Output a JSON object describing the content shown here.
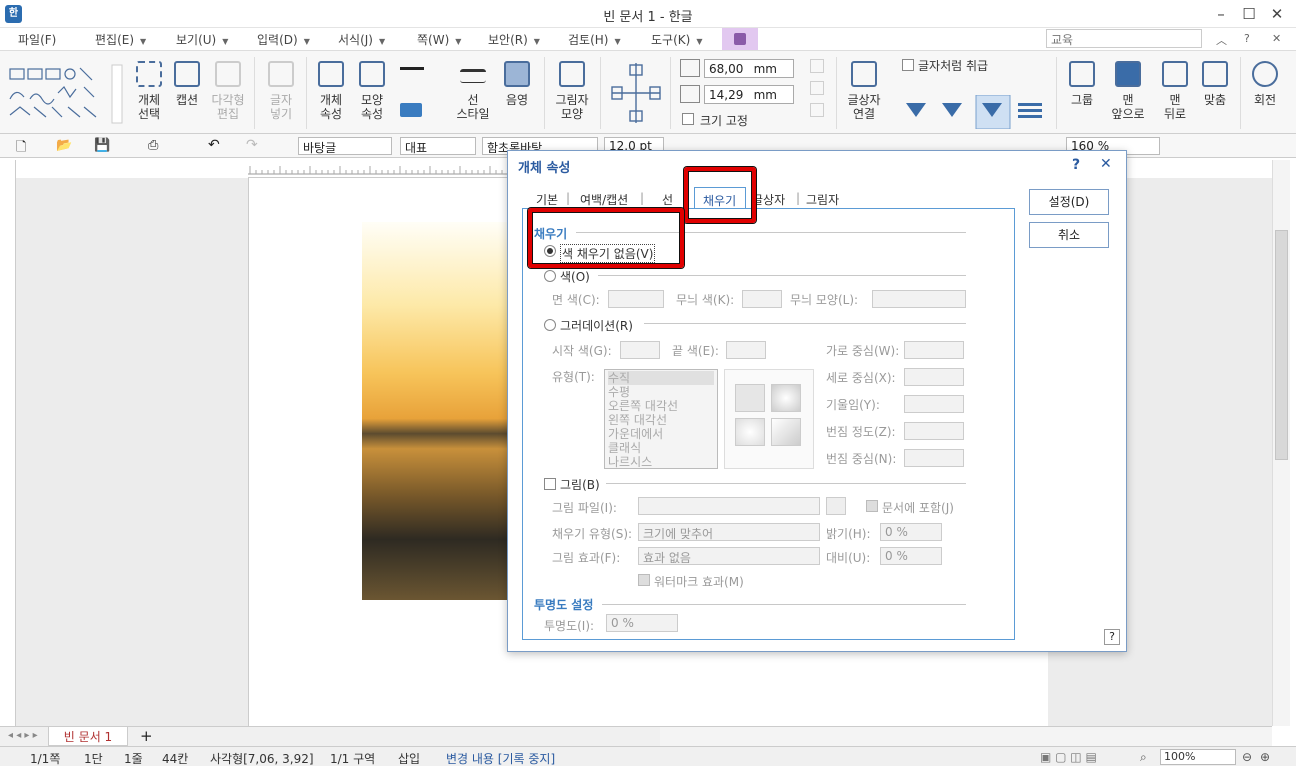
{
  "window": {
    "title": "빈 문서 1 - 한글",
    "app_icon": "hwp-logo-icon"
  },
  "menubar": {
    "items": [
      "파일(F)",
      "편집(E)",
      "보기(U)",
      "입력(D)",
      "서식(J)",
      "쪽(W)",
      "보안(R)",
      "검토(H)",
      "도구(K)"
    ],
    "search_value": "교육"
  },
  "ribbon": {
    "object_select": "개체\n선택",
    "caption": "캡션",
    "multi_edit": "다각형\n편집",
    "text_insert": "글자\n넣기",
    "object_props": "개체\n속성",
    "shape_props": "모양\n속성",
    "line_style": "선\n스타일",
    "shadow": "음영",
    "picture_shape": "그림자\n모양",
    "width_value": "68,00",
    "height_value": "14,29",
    "unit": "mm",
    "size_fixed": "크기 고정",
    "treat_as_char": "글자처럼 취급",
    "text_wrap": "글상자\n연결",
    "group": "그룹",
    "front": "맨\n앞으로",
    "back": "맨\n뒤로",
    "align": "맞춤",
    "rotate": "회전"
  },
  "toolbar2": {
    "style": "바탕글",
    "lang": "대표",
    "font": "함초롬바탕",
    "size": "12.0",
    "size_unit": "pt",
    "zoom": "160"
  },
  "doc_tab": "빈 문서 1",
  "status": {
    "page": "1/1쪽",
    "section_col": "1단",
    "line": "1줄",
    "col": "44칸",
    "shape_info": "사각형[7,06, 3,92]",
    "area": "1/1 구역",
    "insert": "삽입",
    "track": "변경 내용 [기록 중지]",
    "zoom": "100%"
  },
  "dialog": {
    "title": "개체 속성",
    "help": "?",
    "close": "✕",
    "tabs": [
      "기본",
      "여백/캡션",
      "선",
      "채우기",
      "글상자",
      "그림자"
    ],
    "active_tab": "채우기",
    "ok": "설정(D)",
    "cancel": "취소",
    "fill_group": "채우기",
    "no_fill": "색 채우기 없음(V)",
    "color": "색(O)",
    "face_color": "면 색(C):",
    "pattern_color": "무늬 색(K):",
    "pattern_shape": "무늬 모양(L):",
    "gradient": "그러데이션(R)",
    "start_color": "시작 색(G):",
    "end_color": "끝 색(E):",
    "type": "유형(T):",
    "gradient_types": [
      "수직",
      "수평",
      "오른쪽 대각선",
      "왼쪽 대각선",
      "가운데에서",
      "클래식",
      "나르시스"
    ],
    "h_center": "가로 중심(W):",
    "v_center": "세로 중심(X):",
    "tilt": "기울임(Y):",
    "blur_level": "번짐 정도(Z):",
    "blur_center": "번짐 중심(N):",
    "picture": "그림(B)",
    "picture_file": "그림 파일(I):",
    "include_in_doc": "문서에 포함(J)",
    "fill_type": "채우기 유형(S):",
    "fill_type_value": "크기에 맞추어",
    "brightness": "밝기(H):",
    "brightness_value": "0 %",
    "picture_effect": "그림 효과(F):",
    "picture_effect_value": "효과 없음",
    "contrast": "대비(U):",
    "contrast_value": "0 %",
    "watermark": "워터마크 효과(M)",
    "transparency_group": "투명도 설정",
    "transparency": "투명도(I):",
    "transparency_value": "0 %"
  },
  "colors": {
    "accent": "#3a7cc0",
    "highlight_red": "#e00000"
  }
}
